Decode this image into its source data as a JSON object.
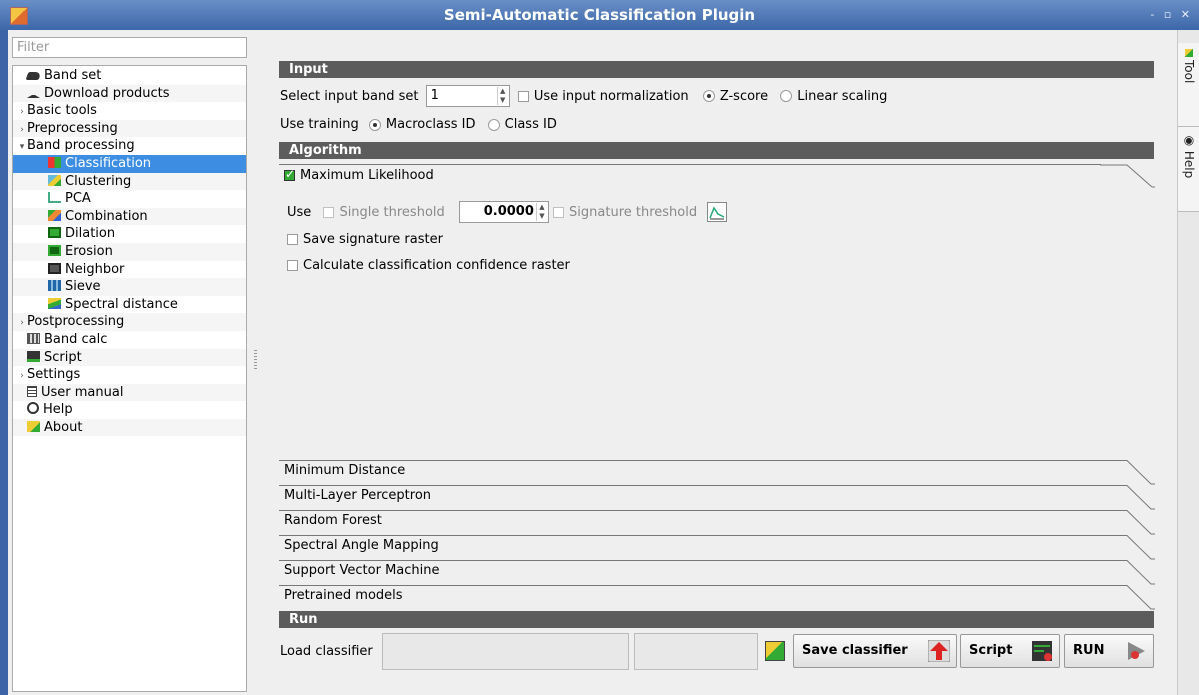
{
  "window": {
    "title": "Semi-Automatic Classification Plugin",
    "controls": "- ▫ ✕"
  },
  "filter": {
    "placeholder": "Filter"
  },
  "tree": [
    {
      "label": "Band set",
      "level": 1,
      "icon": "band-set-icon"
    },
    {
      "label": "Download products",
      "level": 1,
      "icon": "download-icon"
    },
    {
      "label": "Basic tools",
      "level": 0,
      "arrow": "›"
    },
    {
      "label": "Preprocessing",
      "level": 0,
      "arrow": "›"
    },
    {
      "label": "Band processing",
      "level": 0,
      "arrow": "▾"
    },
    {
      "label": "Classification",
      "level": 2,
      "icon": "classification-icon",
      "selected": true
    },
    {
      "label": "Clustering",
      "level": 2,
      "icon": "clustering-icon"
    },
    {
      "label": "PCA",
      "level": 2,
      "icon": "pca-icon"
    },
    {
      "label": "Combination",
      "level": 2,
      "icon": "combination-icon"
    },
    {
      "label": "Dilation",
      "level": 2,
      "icon": "dilation-icon"
    },
    {
      "label": "Erosion",
      "level": 2,
      "icon": "erosion-icon"
    },
    {
      "label": "Neighbor",
      "level": 2,
      "icon": "neighbor-icon"
    },
    {
      "label": "Sieve",
      "level": 2,
      "icon": "sieve-icon"
    },
    {
      "label": "Spectral distance",
      "level": 2,
      "icon": "spectral-distance-icon"
    },
    {
      "label": "Postprocessing",
      "level": 0,
      "arrow": "›"
    },
    {
      "label": "Band calc",
      "level": 1,
      "icon": "band-calc-icon"
    },
    {
      "label": "Script",
      "level": 1,
      "icon": "script-icon"
    },
    {
      "label": "Settings",
      "level": 0,
      "arrow": "›"
    },
    {
      "label": "User manual",
      "level": 1,
      "icon": "manual-icon"
    },
    {
      "label": "Help",
      "level": 1,
      "icon": "help-icon"
    },
    {
      "label": "About",
      "level": 1,
      "icon": "about-icon"
    }
  ],
  "input": {
    "header": "Input",
    "band_set_label": "Select input band set",
    "band_set_value": "1",
    "normalization_label": "Use input normalization",
    "zscore_label": "Z-score",
    "linear_label": "Linear scaling",
    "use_training_label": "Use training",
    "macroclass_label": "Macroclass ID",
    "class_label": "Class ID"
  },
  "algorithm": {
    "header": "Algorithm",
    "ml_title": "Maximum Likelihood",
    "use_label": "Use",
    "single_threshold_label": "Single threshold",
    "threshold_value": "0.0000",
    "signature_threshold_label": "Signature threshold",
    "save_signature_label": "Save signature raster",
    "confidence_label": "Calculate classification confidence raster",
    "other_tabs": [
      "Minimum Distance",
      "Multi-Layer Perceptron",
      "Random Forest",
      "Spectral Angle Mapping",
      "Support Vector Machine",
      "Pretrained models"
    ]
  },
  "run": {
    "header": "Run",
    "load_classifier_label": "Load classifier",
    "save_classifier_label": "Save classifier",
    "script_label": "Script",
    "run_label": "RUN"
  },
  "dock": {
    "tool_label": "Tool",
    "help_label": "Help"
  }
}
